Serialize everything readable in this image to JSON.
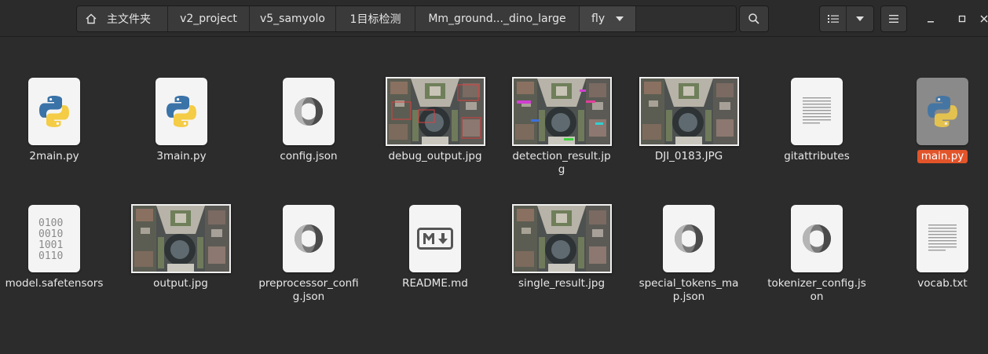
{
  "breadcrumbs": [
    {
      "label": "主文件夹",
      "icon": "home-icon"
    },
    {
      "label": "v2_project"
    },
    {
      "label": "v5_samyolo"
    },
    {
      "label": "1目标检测"
    },
    {
      "label": "Mm_ground..._dino_large"
    },
    {
      "label": "fly",
      "icon": "chevron-down-icon"
    }
  ],
  "toolbar": {
    "search_icon": "search-icon",
    "list_view_icon": "list-view-icon",
    "view_options_icon": "chevron-down-icon",
    "menu_icon": "hamburger-menu-icon"
  },
  "window_controls": [
    "minimize-icon",
    "maximize-icon",
    "close-icon"
  ],
  "files": [
    {
      "name": "2main.py",
      "type": "python"
    },
    {
      "name": "3main.py",
      "type": "python"
    },
    {
      "name": "config.json",
      "type": "json"
    },
    {
      "name": "debug_output.jpg",
      "type": "image"
    },
    {
      "name": "detection_result.jpg",
      "type": "image"
    },
    {
      "name": "DJI_0183.JPG",
      "type": "image"
    },
    {
      "name": "gitattributes",
      "type": "text"
    },
    {
      "name": "main.py",
      "type": "python",
      "selected": true
    },
    {
      "name": "model.safetensors",
      "type": "binary"
    },
    {
      "name": "output.jpg",
      "type": "image"
    },
    {
      "name": "preprocessor_config.json",
      "type": "json"
    },
    {
      "name": "README.md",
      "type": "markdown"
    },
    {
      "name": "single_result.jpg",
      "type": "image"
    },
    {
      "name": "special_tokens_map.json",
      "type": "json"
    },
    {
      "name": "tokenizer_config.json",
      "type": "json"
    },
    {
      "name": "vocab.txt",
      "type": "text"
    }
  ],
  "colors": {
    "background": "#2c2c2c",
    "header": "#2b2b2b",
    "selection": "#e2542a",
    "python_blue": "#3a73a8",
    "python_yellow": "#f4cc45"
  }
}
